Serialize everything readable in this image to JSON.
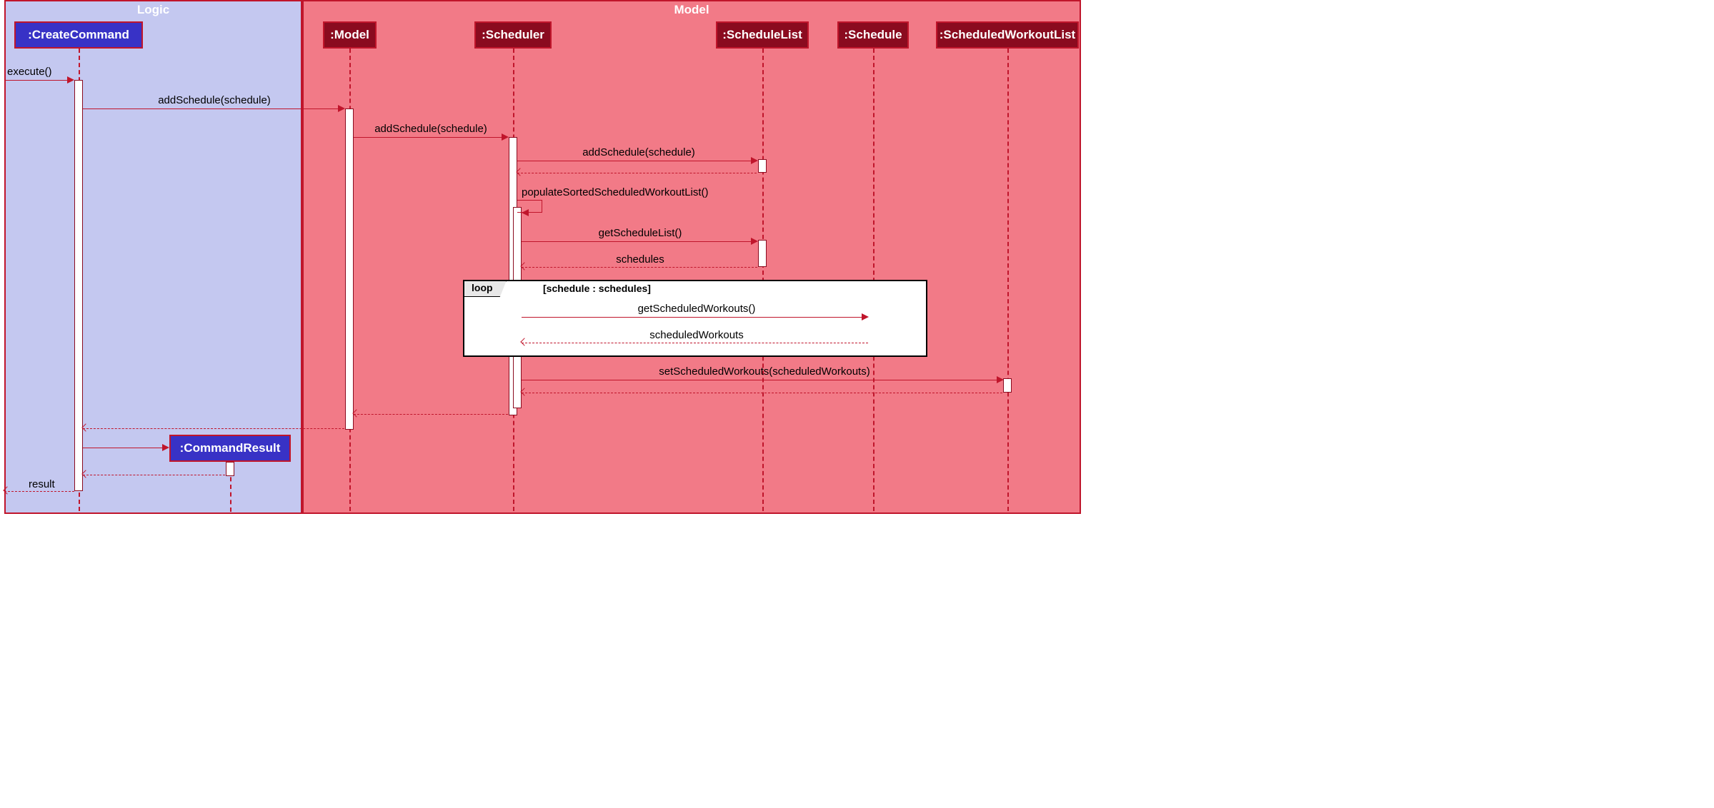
{
  "frames": {
    "logic": {
      "title": "Logic"
    },
    "model": {
      "title": "Model"
    }
  },
  "participants": {
    "createCommand": ":CreateCommand",
    "commandResult": ":CommandResult",
    "model": ":Model",
    "scheduler": ":Scheduler",
    "scheduleList": ":ScheduleList",
    "schedule": ":Schedule",
    "scheduledWorkoutList": ":ScheduledWorkoutList"
  },
  "messages": {
    "execute": "execute()",
    "addSchedule1": "addSchedule(schedule)",
    "addSchedule2": "addSchedule(schedule)",
    "addSchedule3": "addSchedule(schedule)",
    "populate": "populateSortedScheduledWorkoutList()",
    "getScheduleList": "getScheduleList()",
    "schedules": "schedules",
    "getScheduledWorkouts": "getScheduledWorkouts()",
    "scheduledWorkouts": "scheduledWorkouts",
    "setScheduledWorkouts": "setScheduledWorkouts(scheduledWorkouts)",
    "result": "result"
  },
  "loop": {
    "label": "loop",
    "guard": "[schedule : schedules]"
  }
}
